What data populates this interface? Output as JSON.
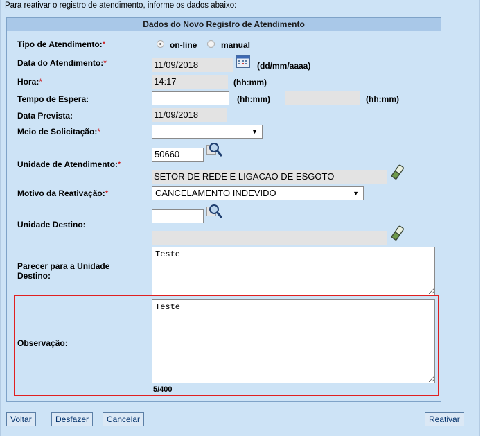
{
  "intro_text": "Para reativar o registro de atendimento, informe os dados abaixo:",
  "form": {
    "header": "Dados do Novo Registro de Atendimento",
    "tipo_atendimento": {
      "label": "Tipo de Atendimento:",
      "req": "*",
      "options": [
        "on-line",
        "manual"
      ],
      "selected": "on-line"
    },
    "data_atendimento": {
      "label": "Data do Atendimento:",
      "req": "*",
      "value": "11/09/2018",
      "format": "(dd/mm/aaaa)"
    },
    "hora": {
      "label": "Hora:",
      "req": "*",
      "value": "14:17",
      "format": "(hh:mm)"
    },
    "tempo_espera": {
      "label": "Tempo de Espera:",
      "value": "",
      "format1": "(hh:mm)",
      "value2": "",
      "format2": "(hh:mm)"
    },
    "data_prevista": {
      "label": "Data Prevista:",
      "value": "11/09/2018"
    },
    "meio_solicitacao": {
      "label": "Meio de Solicitação:",
      "req": "*",
      "selected": ""
    },
    "unidade_atendimento": {
      "label": "Unidade de Atendimento:",
      "req": "*",
      "code": "50660",
      "name": "SETOR DE REDE E LIGACAO DE ESGOTO"
    },
    "motivo_reativacao": {
      "label": "Motivo da Reativação:",
      "req": "*",
      "selected": "CANCELAMENTO INDEVIDO"
    },
    "unidade_destino": {
      "label": "Unidade Destino:",
      "code": "",
      "name": ""
    },
    "parecer": {
      "label": "Parecer para a Unidade Destino:",
      "value": "Teste"
    },
    "observacao": {
      "label": "Observação:",
      "value": "Teste",
      "counter": "5/400"
    }
  },
  "buttons": {
    "voltar": "Voltar",
    "desfazer": "Desfazer",
    "cancelar": "Cancelar",
    "reativar": "Reativar"
  },
  "icons": {
    "calendar": "calendar-icon",
    "search": "magnifier-icon",
    "clear": "eraser-icon"
  },
  "colors": {
    "required": "#cc0000",
    "panel_bg": "#cde3f6",
    "header_bg": "#a9c8e8",
    "highlight": "#e02020"
  }
}
